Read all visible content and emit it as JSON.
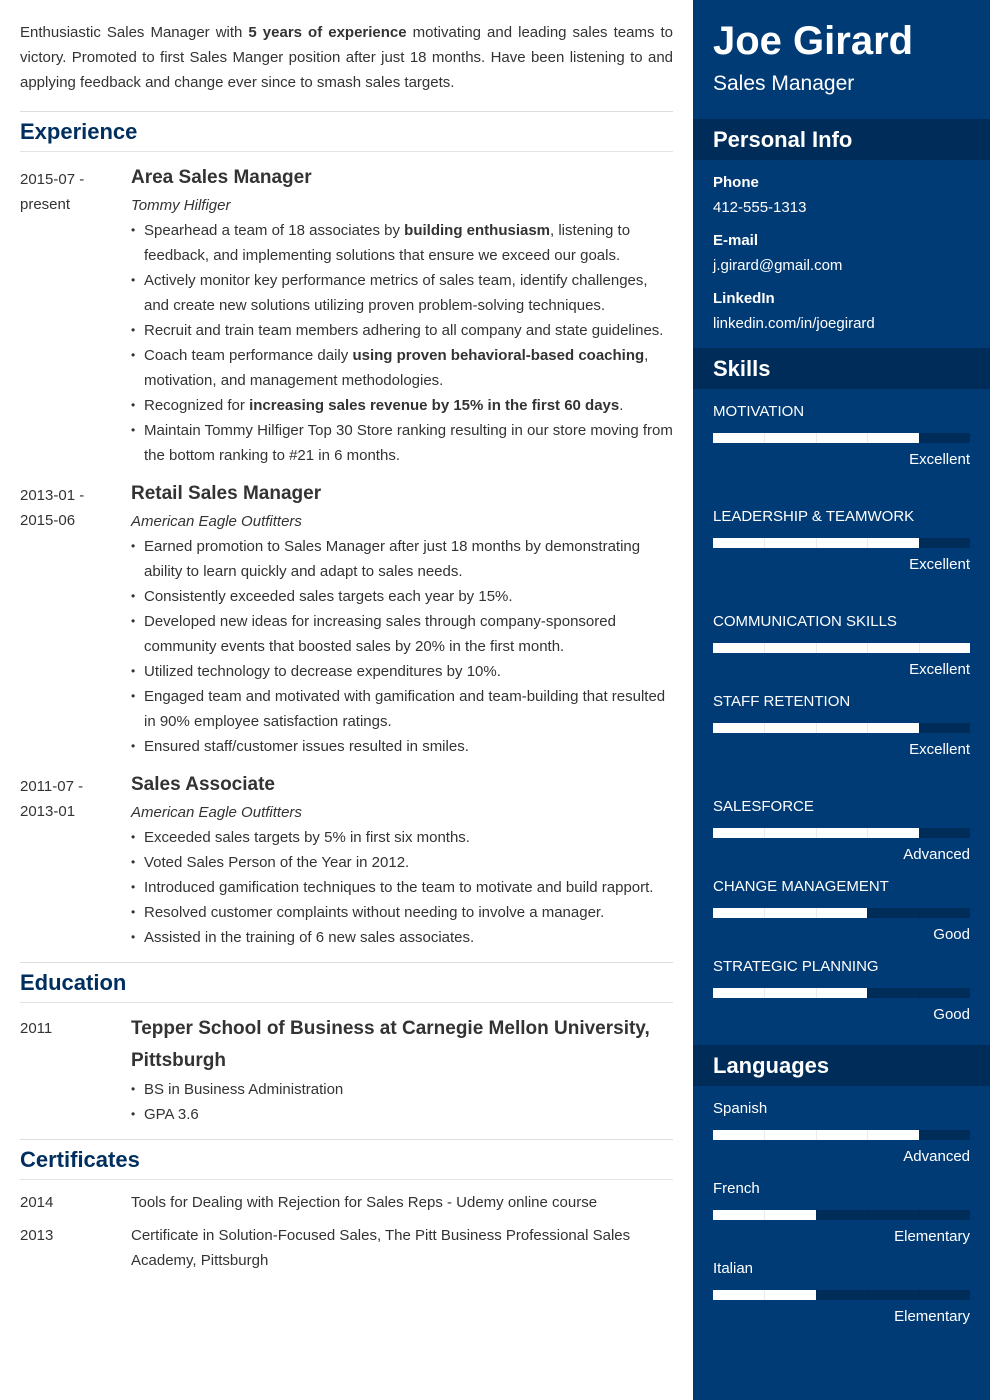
{
  "summary": {
    "before": "Enthusiastic Sales Manager with ",
    "bold": "5 years of experience",
    "after": " motivating and leading sales teams to victory. Promoted to first Sales Manger position after just 18 months. Have been listening to and applying feedback and change ever since to smash sales targets."
  },
  "sections": {
    "experience": "Experience",
    "education": "Education",
    "certificates": "Certificates"
  },
  "experience": [
    {
      "date_start": "2015-07 -",
      "date_end": "present",
      "role": "Area Sales Manager",
      "company": "Tommy Hilfiger",
      "bullets": [
        {
          "pre": "Spearhead a team of 18 associates by ",
          "bold": "building enthusiasm",
          "post": ", listening to feedback, and implementing solutions that ensure we exceed our goals."
        },
        {
          "pre": "Actively monitor key performance metrics of sales team, identify challenges, and create new solutions utilizing proven problem-solving techniques.",
          "bold": "",
          "post": ""
        },
        {
          "pre": "Recruit and train team members adhering to all company and state guidelines.",
          "bold": "",
          "post": ""
        },
        {
          "pre": "Coach team performance daily ",
          "bold": "using proven behavioral-based coaching",
          "post": ", motivation, and management methodologies."
        },
        {
          "pre": "Recognized for ",
          "bold": "increasing sales revenue by 15% in the first 60 days",
          "post": "."
        },
        {
          "pre": "Maintain Tommy Hilfiger Top 30 Store ranking resulting in our store moving from the bottom ranking to #21 in 6 months.",
          "bold": "",
          "post": ""
        }
      ]
    },
    {
      "date_start": "2013-01 -",
      "date_end": "2015-06",
      "role": "Retail Sales Manager",
      "company": "American Eagle Outfitters",
      "bullets": [
        {
          "pre": "Earned promotion to Sales Manager after just 18 months by demonstrating ability to learn quickly and adapt to sales needs.",
          "bold": "",
          "post": ""
        },
        {
          "pre": "Consistently exceeded sales targets each year by 15%.",
          "bold": "",
          "post": ""
        },
        {
          "pre": "Developed new ideas for increasing sales through company-sponsored community events that boosted sales by 20% in the first month.",
          "bold": "",
          "post": ""
        },
        {
          "pre": "Utilized technology to decrease expenditures by 10%.",
          "bold": "",
          "post": ""
        },
        {
          "pre": "Engaged team and motivated with gamification and team-building that resulted in 90% employee satisfaction ratings.",
          "bold": "",
          "post": ""
        },
        {
          "pre": "Ensured staff/customer issues resulted in smiles.",
          "bold": "",
          "post": ""
        }
      ]
    },
    {
      "date_start": "2011-07 -",
      "date_end": "2013-01",
      "role": "Sales Associate",
      "company": "American Eagle Outfitters",
      "bullets": [
        {
          "pre": "Exceeded sales targets by 5% in first six months.",
          "bold": "",
          "post": ""
        },
        {
          "pre": "Voted Sales Person of the Year in 2012.",
          "bold": "",
          "post": ""
        },
        {
          "pre": "Introduced gamification techniques to the team to motivate and build rapport.",
          "bold": "",
          "post": ""
        },
        {
          "pre": "Resolved customer complaints without needing to involve a manager.",
          "bold": "",
          "post": ""
        },
        {
          "pre": "Assisted in the training of 6 new sales associates.",
          "bold": "",
          "post": ""
        }
      ]
    }
  ],
  "education": {
    "year": "2011",
    "school": "Tepper School of Business at Carnegie Mellon University, Pittsburgh",
    "bullets": [
      "BS in Business Administration",
      "GPA 3.6"
    ]
  },
  "certificates": [
    {
      "year": "2014",
      "text": "Tools for Dealing with Rejection for Sales Reps - Udemy online course"
    },
    {
      "year": "2013",
      "text": "Certificate in Solution-Focused Sales, The Pitt Business Professional Sales Academy, Pittsburgh"
    }
  ],
  "sidebar": {
    "name": "Joe Girard",
    "title": "Sales Manager",
    "personal_info_heading": "Personal Info",
    "personal": [
      {
        "label": "Phone",
        "value": "412-555-1313"
      },
      {
        "label": "E-mail",
        "value": "j.girard@gmail.com"
      },
      {
        "label": "LinkedIn",
        "value": "linkedin.com/in/joegirard"
      }
    ],
    "skills_heading": "Skills",
    "skills": [
      {
        "name": "MOTIVATION",
        "level": "Excellent",
        "rating": 4,
        "max": 5
      },
      {
        "name": "LEADERSHIP & TEAMWORK",
        "level": "Excellent",
        "rating": 4,
        "max": 5
      },
      {
        "name": "COMMUNICATION SKILLS",
        "level": "Excellent",
        "rating": 5,
        "max": 5
      },
      {
        "name": "STAFF RETENTION",
        "level": "Excellent",
        "rating": 4,
        "max": 5
      },
      {
        "name": "SALESFORCE",
        "level": "Advanced",
        "rating": 4,
        "max": 5
      },
      {
        "name": "CHANGE MANAGEMENT",
        "level": "Good",
        "rating": 3,
        "max": 5
      },
      {
        "name": "STRATEGIC PLANNING",
        "level": "Good",
        "rating": 3,
        "max": 5
      }
    ],
    "languages_heading": "Languages",
    "languages": [
      {
        "name": "Spanish",
        "level": "Advanced",
        "rating": 4,
        "max": 5
      },
      {
        "name": "French",
        "level": "Elementary",
        "rating": 2,
        "max": 5
      },
      {
        "name": "Italian",
        "level": "Elementary",
        "rating": 2,
        "max": 5
      }
    ]
  },
  "colors": {
    "sidebar_bg": "#003b75",
    "sidebar_header_bg": "#002c59",
    "heading": "#002f5f",
    "text": "#333333"
  }
}
